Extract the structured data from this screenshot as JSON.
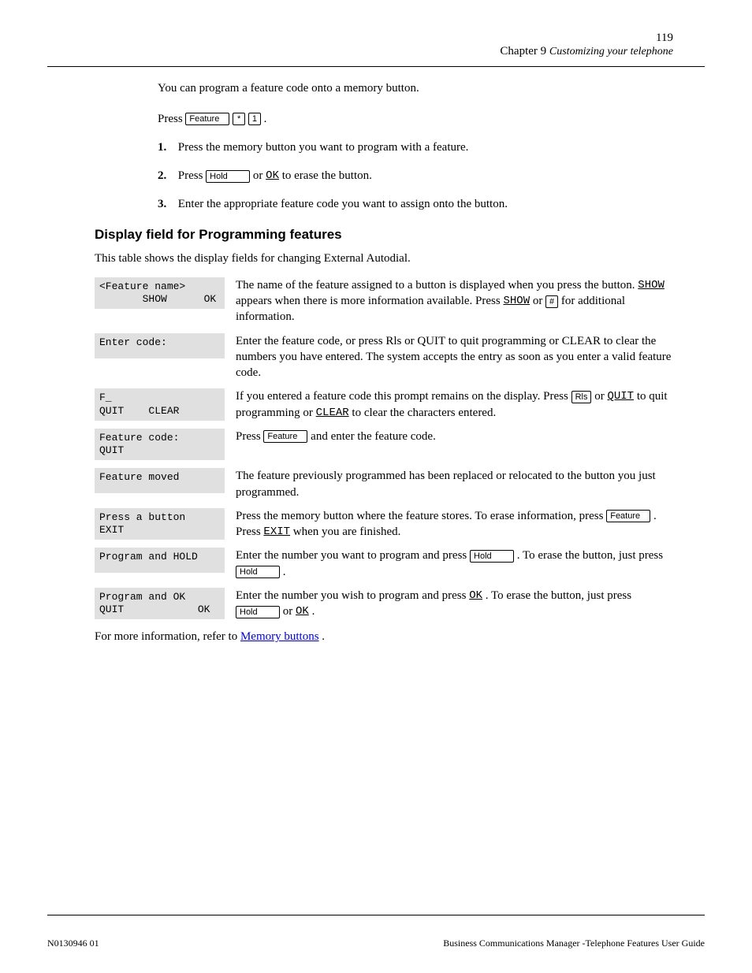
{
  "header": {
    "page_number": "119",
    "chapter": "Chapter 9",
    "chapter_title": "Customizing your telephone"
  },
  "intro_sentences": {
    "s1": "You can program a feature code onto a memory button.",
    "s2a": "Press ",
    "s2b": "."
  },
  "keys": {
    "feature": "Feature",
    "star": "*",
    "one": "1",
    "hold": "Hold",
    "rls": "Rls",
    "hash": "#"
  },
  "softkeys": {
    "ok": "OK",
    "show": "SHOW",
    "clear": "CLEAR",
    "quit": "QUIT",
    "exit": "EXIT"
  },
  "steps": {
    "s1a": "Press the memory button you want to program with a feature.",
    "s2a": "Press ",
    "s2b": " or ",
    "s2c": " to erase the button.",
    "s3a": "Enter the appropriate feature code you want to assign onto the button.",
    "n1": "1.",
    "n2": "2.",
    "n3": "3."
  },
  "subhead": "Display field for Programming features",
  "subtext": "This table shows the display fields for changing External Autodial.",
  "screens": {
    "r1": "<Feature name>\n       SHOW      OK",
    "r2": "Enter code:",
    "r3": "F_\nQUIT    CLEAR",
    "r4": "Feature code:\nQUIT",
    "r5": "Feature moved",
    "r6": "Press a button\nEXIT",
    "r7": "Program and HOLD",
    "r8": "Program and OK\nQUIT            OK"
  },
  "desc": {
    "r1a": "The name of the feature assigned to a button is displayed when you press the button. ",
    "r1b": " appears when there is more information available. Press ",
    "r1c": " or ",
    "r1d": " for additional information.",
    "r2": "Enter the feature code, or press Rls or QUIT to quit programming or CLEAR to clear the numbers you have entered. The system accepts the entry as soon as you enter a valid feature code.",
    "r3a": "If you entered a feature code this prompt remains on the display. Press ",
    "r3b": " or ",
    "r3c": " to quit programming or ",
    "r3d": " to clear the characters entered.",
    "r4a": "Press ",
    "r4b": " and enter the feature code.",
    "r5": "The feature previously programmed has been replaced or relocated to the button you just programmed.",
    "r6a": "Press the memory button where the feature stores. To erase information, press ",
    "r6b": ".",
    "r6c": " Press ",
    "r6d": " when you are finished.",
    "r7a": "Enter the number you want to program and press ",
    "r7b": ". To erase the button, just press ",
    "r7c": ".",
    "r8a": "Enter the number you wish to program and press ",
    "r8b": ". To erase the button, just press ",
    "r8c": " or ",
    "r8d": "."
  },
  "more_info_a": "For more information, refer to ",
  "more_info_link": "Memory buttons",
  "more_info_b": ".",
  "footer": {
    "left": "N0130946 01",
    "right": "Business Communications Manager -Telephone Features User Guide"
  }
}
